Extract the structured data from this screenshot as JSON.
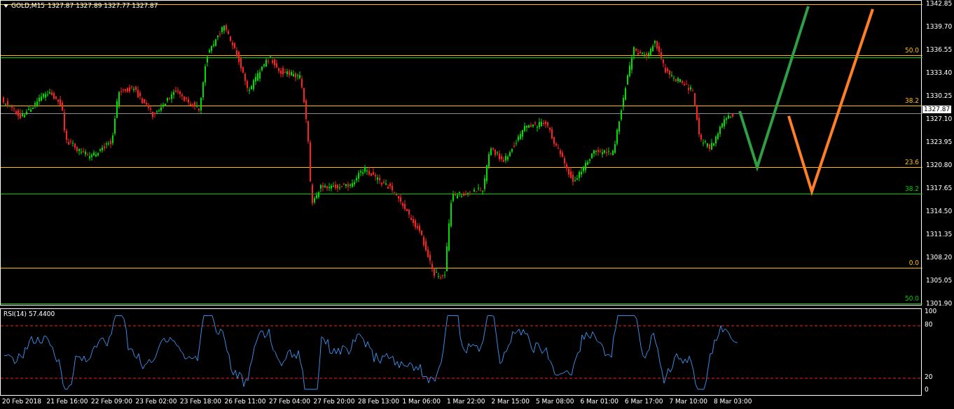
{
  "chart": {
    "symbol": "GOLD,M15",
    "quote": "1327.87 1327.89 1327.77 1327.87",
    "price_tag": "1327.87",
    "price_axis": [
      "1342.85",
      "1339.70",
      "1336.55",
      "1333.40",
      "1330.25",
      "1327.10",
      "1323.95",
      "1320.80",
      "1317.65",
      "1314.50",
      "1311.35",
      "1308.20",
      "1305.05",
      "1301.90"
    ],
    "levels": [
      {
        "color": "#ffc000"
      },
      {
        "label": "50.0",
        "color": "#ffc000"
      },
      {
        "color": "#00d000"
      },
      {
        "label": "38.2",
        "color": "#ffc000"
      },
      {
        "label": "23.6",
        "color": "#ffc000"
      },
      {
        "label": "38.2",
        "color": "#00d000"
      },
      {
        "label": "0.0",
        "color": "#ffc000"
      },
      {
        "label": "50.0",
        "color": "#00d000"
      }
    ]
  },
  "rsi": {
    "label": "RSI(14) 57.4400",
    "axis": [
      "100",
      "80",
      "20",
      "0"
    ]
  },
  "time_axis": [
    "20 Feb 2018",
    "21 Feb 16:00",
    "22 Feb 09:00",
    "23 Feb 02:00",
    "23 Feb 18:00",
    "26 Feb 11:00",
    "27 Feb 04:00",
    "27 Feb 20:00",
    "28 Feb 13:00",
    "1 Mar 06:00",
    "1 Mar 22:00",
    "2 Mar 15:00",
    "5 Mar 08:00",
    "6 Mar 01:00",
    "6 Mar 17:00",
    "7 Mar 10:00",
    "8 Mar 03:00"
  ]
}
